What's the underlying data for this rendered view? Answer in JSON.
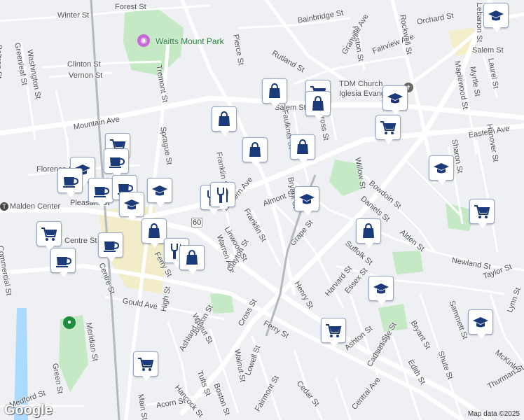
{
  "parks": [
    {
      "name": "Waitts Mount Park"
    }
  ],
  "places": [
    {
      "name": "TDM Church"
    },
    {
      "name": "Iglesia Evangél"
    },
    {
      "name": "Malden Center"
    }
  ],
  "streets": [
    "Forest St",
    "Winter St",
    "Bainbridge St",
    "Beltran St",
    "Greenleaf St",
    "Washington St",
    "Clinton St",
    "Vernon St",
    "Pierce St",
    "Rutland St",
    "Preston St",
    "Granville Ave",
    "Fairview Ave",
    "Orchard St",
    "Rockwell St",
    "Lebanon St",
    "Salem St",
    "Salem St",
    "Mountain Ave",
    "Tremont St",
    "Sprague St",
    "Franklin St",
    "Faulkner St",
    "Cross St",
    "Eastern Ave",
    "Florence St",
    "Pleasant St",
    "Centre St",
    "Eastern Ave",
    "Almont St",
    "Bryant St",
    "Bowdoin St",
    "Daniels St",
    "Sharon St",
    "Hanover St",
    "Maplewood St",
    "Myrtle St",
    "Laurel St",
    "Linwood St",
    "Warren Ave",
    "Franklin St",
    "Clayton St",
    "Grape St",
    "Willow St",
    "Suffolk St",
    "Alden St",
    "Newland St",
    "Taylor St",
    "Harvard St",
    "Essex St",
    "Henry St",
    "Gould Ave",
    "Walnut St",
    "Cross St",
    "Ferry St",
    "Judson St",
    "Ashland St",
    "High St",
    "Meridian St",
    "Green St",
    "Ashton St",
    "Coolidge St",
    "Carlson St",
    "Edith St",
    "Sammett St",
    "Bryant St",
    "Shute St",
    "Lynn St",
    "McKinley",
    "Thurman St",
    "Tufts St",
    "Boston St",
    "Lowell St",
    "Walnut St",
    "Fairmont St",
    "Cedar St",
    "Central Ave",
    "Hancock St",
    "Main St",
    "Acorn St",
    "Medford St",
    "Commercial St",
    "Centre St",
    "Ferry St"
  ],
  "route_badge": "60",
  "markers": [
    {
      "type": "school-icon"
    },
    {
      "type": "shopping-bag-icon"
    },
    {
      "type": "shopping-cart-icon"
    },
    {
      "type": "shopping-bag-icon"
    },
    {
      "type": "school-icon"
    },
    {
      "type": "shopping-cart-icon"
    },
    {
      "type": "shopping-bag-icon"
    },
    {
      "type": "shopping-bag-icon"
    },
    {
      "type": "shopping-bag-icon"
    },
    {
      "type": "shopping-cart-icon"
    },
    {
      "type": "coffee-icon"
    },
    {
      "type": "school-icon"
    },
    {
      "type": "coffee-icon"
    },
    {
      "type": "coffee-icon"
    },
    {
      "type": "school-icon"
    },
    {
      "type": "coffee-icon"
    },
    {
      "type": "school-icon"
    },
    {
      "type": "restaurant-icon"
    },
    {
      "type": "restaurant-icon"
    },
    {
      "type": "shopping-bag-icon"
    },
    {
      "type": "shopping-cart-icon"
    },
    {
      "type": "coffee-icon"
    },
    {
      "type": "restaurant-icon"
    },
    {
      "type": "shopping-bag-icon"
    },
    {
      "type": "coffee-icon"
    },
    {
      "type": "school-icon"
    },
    {
      "type": "school-icon"
    },
    {
      "type": "shopping-cart-icon"
    },
    {
      "type": "shopping-bag-icon"
    },
    {
      "type": "school-icon"
    },
    {
      "type": "school-icon"
    },
    {
      "type": "shopping-cart-icon"
    },
    {
      "type": "shopping-cart-icon"
    }
  ],
  "footer": {
    "map_data": "Map data ©2025",
    "logo": "Google"
  },
  "colors": {
    "road": "#ffffff",
    "park": "#c5e8c5",
    "water": "#aadaff",
    "pin_icon": "#1a3a7a",
    "rail": "#b5b8bd"
  }
}
